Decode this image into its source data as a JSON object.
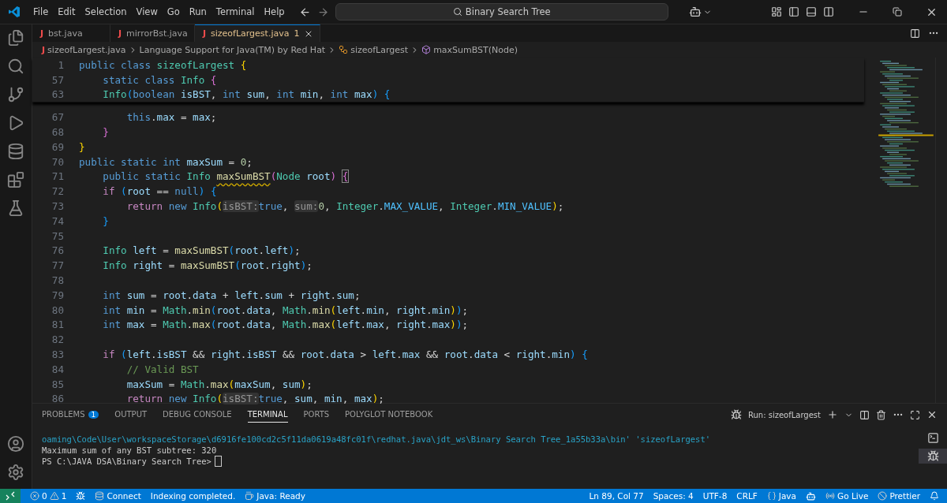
{
  "menu": [
    "File",
    "Edit",
    "Selection",
    "View",
    "Go",
    "Run",
    "Terminal",
    "Help"
  ],
  "search": {
    "value": "Binary Search Tree"
  },
  "tabs": [
    {
      "icon": "J",
      "label": "bst.java",
      "selected": false
    },
    {
      "icon": "J",
      "label": "mirrorBst.java",
      "selected": false
    },
    {
      "icon": "J",
      "label": "sizeofLargest.java",
      "selected": true,
      "problems": "1"
    }
  ],
  "breadcrumb": [
    {
      "icon": "J",
      "label": "sizeofLargest.java"
    },
    {
      "label": "Language Support for Java(TM) by Red Hat"
    },
    {
      "label": "sizeofLargest"
    },
    {
      "label": "maxSumBST(Node)"
    }
  ],
  "sticky_lines": [
    {
      "n": "1",
      "tokens": [
        {
          "kind": "kw",
          "text": "public class "
        },
        {
          "kind": "type",
          "text": "sizeofLargest "
        },
        {
          "kind": "b1",
          "text": "{"
        }
      ]
    },
    {
      "n": "57",
      "tokens": [
        {
          "kind": "kw",
          "text": "    static class "
        },
        {
          "kind": "type",
          "text": "Info "
        },
        {
          "kind": "b2",
          "text": "{"
        }
      ]
    },
    {
      "n": "63",
      "tokens": [
        {
          "kind": "type",
          "text": "    Info"
        },
        {
          "kind": "b3",
          "text": "("
        },
        {
          "kind": "kw",
          "text": "boolean "
        },
        {
          "kind": "var",
          "text": "isBST"
        },
        {
          "kind": "p",
          "text": ", "
        },
        {
          "kind": "kw",
          "text": "int "
        },
        {
          "kind": "var",
          "text": "sum"
        },
        {
          "kind": "p",
          "text": ", "
        },
        {
          "kind": "kw",
          "text": "int "
        },
        {
          "kind": "var",
          "text": "min"
        },
        {
          "kind": "p",
          "text": ", "
        },
        {
          "kind": "kw",
          "text": "int "
        },
        {
          "kind": "var",
          "text": "max"
        },
        {
          "kind": "b3",
          "text": ") "
        },
        {
          "kind": "b3",
          "text": "{"
        }
      ]
    }
  ],
  "lines": [
    {
      "n": "67",
      "tokens": [
        {
          "kind": "kw",
          "text": "        this"
        },
        {
          "kind": "p",
          "text": "."
        },
        {
          "kind": "var",
          "text": "max"
        },
        {
          "kind": "p",
          "text": " = "
        },
        {
          "kind": "var",
          "text": "max"
        },
        {
          "kind": "p",
          "text": ";"
        }
      ]
    },
    {
      "n": "68",
      "tokens": [
        {
          "kind": "b2",
          "text": "    }"
        }
      ]
    },
    {
      "n": "69",
      "tokens": [
        {
          "kind": "b1",
          "text": "}"
        }
      ]
    },
    {
      "n": "70",
      "tokens": [
        {
          "kind": "kw",
          "text": "public static int "
        },
        {
          "kind": "var",
          "text": "maxSum"
        },
        {
          "kind": "p",
          "text": " = "
        },
        {
          "kind": "num",
          "text": "0"
        },
        {
          "kind": "p",
          "text": ";"
        }
      ]
    },
    {
      "n": "71",
      "tokens": [
        {
          "kind": "kw",
          "text": "    public static "
        },
        {
          "kind": "type",
          "text": "Info "
        },
        {
          "kind": "fnw",
          "text": "maxSumBST"
        },
        {
          "kind": "b2",
          "text": "("
        },
        {
          "kind": "type",
          "text": "Node "
        },
        {
          "kind": "var",
          "text": "root"
        },
        {
          "kind": "b2",
          "text": ") "
        },
        {
          "kind": "bm",
          "text": "{"
        }
      ]
    },
    {
      "n": "72",
      "tokens": [
        {
          "kind": "ctl",
          "text": "    if "
        },
        {
          "kind": "b3",
          "text": "("
        },
        {
          "kind": "var",
          "text": "root"
        },
        {
          "kind": "p",
          "text": " == "
        },
        {
          "kind": "kw",
          "text": "null"
        },
        {
          "kind": "b3",
          "text": ") "
        },
        {
          "kind": "b3",
          "text": "{"
        }
      ]
    },
    {
      "n": "73",
      "tokens": [
        {
          "kind": "ctl",
          "text": "        return "
        },
        {
          "kind": "kw",
          "text": "new "
        },
        {
          "kind": "type",
          "text": "Info"
        },
        {
          "kind": "b1",
          "text": "("
        },
        {
          "kind": "hint",
          "text": "isBST:"
        },
        {
          "kind": "kw",
          "text": "true"
        },
        {
          "kind": "p",
          "text": ", "
        },
        {
          "kind": "hint",
          "text": "sum:"
        },
        {
          "kind": "num",
          "text": "0"
        },
        {
          "kind": "p",
          "text": ", "
        },
        {
          "kind": "type",
          "text": "Integer"
        },
        {
          "kind": "p",
          "text": "."
        },
        {
          "kind": "const",
          "text": "MAX_VALUE"
        },
        {
          "kind": "p",
          "text": ", "
        },
        {
          "kind": "type",
          "text": "Integer"
        },
        {
          "kind": "p",
          "text": "."
        },
        {
          "kind": "const",
          "text": "MIN_VALUE"
        },
        {
          "kind": "b1",
          "text": ")"
        },
        {
          "kind": "p",
          "text": ";"
        }
      ]
    },
    {
      "n": "74",
      "tokens": [
        {
          "kind": "b3",
          "text": "    }"
        }
      ]
    },
    {
      "n": "75"
    },
    {
      "n": "76",
      "tokens": [
        {
          "kind": "type",
          "text": "    Info "
        },
        {
          "kind": "var",
          "text": "left"
        },
        {
          "kind": "p",
          "text": " = "
        },
        {
          "kind": "fn",
          "text": "maxSumBST"
        },
        {
          "kind": "b3",
          "text": "("
        },
        {
          "kind": "var",
          "text": "root"
        },
        {
          "kind": "p",
          "text": "."
        },
        {
          "kind": "var",
          "text": "left"
        },
        {
          "kind": "b3",
          "text": ")"
        },
        {
          "kind": "p",
          "text": ";"
        }
      ]
    },
    {
      "n": "77",
      "tokens": [
        {
          "kind": "type",
          "text": "    Info "
        },
        {
          "kind": "var",
          "text": "right"
        },
        {
          "kind": "p",
          "text": " = "
        },
        {
          "kind": "fn",
          "text": "maxSumBST"
        },
        {
          "kind": "b3",
          "text": "("
        },
        {
          "kind": "var",
          "text": "root"
        },
        {
          "kind": "p",
          "text": "."
        },
        {
          "kind": "var",
          "text": "right"
        },
        {
          "kind": "b3",
          "text": ")"
        },
        {
          "kind": "p",
          "text": ";"
        }
      ]
    },
    {
      "n": "78"
    },
    {
      "n": "79",
      "tokens": [
        {
          "kind": "kw",
          "text": "    int "
        },
        {
          "kind": "var",
          "text": "sum"
        },
        {
          "kind": "p",
          "text": " = "
        },
        {
          "kind": "var",
          "text": "root"
        },
        {
          "kind": "p",
          "text": "."
        },
        {
          "kind": "var",
          "text": "data"
        },
        {
          "kind": "p",
          "text": " + "
        },
        {
          "kind": "var",
          "text": "left"
        },
        {
          "kind": "p",
          "text": "."
        },
        {
          "kind": "var",
          "text": "sum"
        },
        {
          "kind": "p",
          "text": " + "
        },
        {
          "kind": "var",
          "text": "right"
        },
        {
          "kind": "p",
          "text": "."
        },
        {
          "kind": "var",
          "text": "sum"
        },
        {
          "kind": "p",
          "text": ";"
        }
      ]
    },
    {
      "n": "80",
      "tokens": [
        {
          "kind": "kw",
          "text": "    int "
        },
        {
          "kind": "var",
          "text": "min"
        },
        {
          "kind": "p",
          "text": " = "
        },
        {
          "kind": "type",
          "text": "Math"
        },
        {
          "kind": "p",
          "text": "."
        },
        {
          "kind": "fn",
          "text": "min"
        },
        {
          "kind": "b3",
          "text": "("
        },
        {
          "kind": "var",
          "text": "root"
        },
        {
          "kind": "p",
          "text": "."
        },
        {
          "kind": "var",
          "text": "data"
        },
        {
          "kind": "p",
          "text": ", "
        },
        {
          "kind": "type",
          "text": "Math"
        },
        {
          "kind": "p",
          "text": "."
        },
        {
          "kind": "fn",
          "text": "min"
        },
        {
          "kind": "b1",
          "text": "("
        },
        {
          "kind": "var",
          "text": "left"
        },
        {
          "kind": "p",
          "text": "."
        },
        {
          "kind": "var",
          "text": "min"
        },
        {
          "kind": "p",
          "text": ", "
        },
        {
          "kind": "var",
          "text": "right"
        },
        {
          "kind": "p",
          "text": "."
        },
        {
          "kind": "var",
          "text": "min"
        },
        {
          "kind": "b1",
          "text": ")"
        },
        {
          "kind": "b3",
          "text": ")"
        },
        {
          "kind": "p",
          "text": ";"
        }
      ]
    },
    {
      "n": "81",
      "tokens": [
        {
          "kind": "kw",
          "text": "    int "
        },
        {
          "kind": "var",
          "text": "max"
        },
        {
          "kind": "p",
          "text": " = "
        },
        {
          "kind": "type",
          "text": "Math"
        },
        {
          "kind": "p",
          "text": "."
        },
        {
          "kind": "fn",
          "text": "max"
        },
        {
          "kind": "b3",
          "text": "("
        },
        {
          "kind": "var",
          "text": "root"
        },
        {
          "kind": "p",
          "text": "."
        },
        {
          "kind": "var",
          "text": "data"
        },
        {
          "kind": "p",
          "text": ", "
        },
        {
          "kind": "type",
          "text": "Math"
        },
        {
          "kind": "p",
          "text": "."
        },
        {
          "kind": "fn",
          "text": "max"
        },
        {
          "kind": "b1",
          "text": "("
        },
        {
          "kind": "var",
          "text": "left"
        },
        {
          "kind": "p",
          "text": "."
        },
        {
          "kind": "var",
          "text": "max"
        },
        {
          "kind": "p",
          "text": ", "
        },
        {
          "kind": "var",
          "text": "right"
        },
        {
          "kind": "p",
          "text": "."
        },
        {
          "kind": "var",
          "text": "max"
        },
        {
          "kind": "b1",
          "text": ")"
        },
        {
          "kind": "b3",
          "text": ")"
        },
        {
          "kind": "p",
          "text": ";"
        }
      ]
    },
    {
      "n": "82"
    },
    {
      "n": "83",
      "tokens": [
        {
          "kind": "ctl",
          "text": "    if "
        },
        {
          "kind": "b3",
          "text": "("
        },
        {
          "kind": "var",
          "text": "left"
        },
        {
          "kind": "p",
          "text": "."
        },
        {
          "kind": "var",
          "text": "isBST"
        },
        {
          "kind": "p",
          "text": " && "
        },
        {
          "kind": "var",
          "text": "right"
        },
        {
          "kind": "p",
          "text": "."
        },
        {
          "kind": "var",
          "text": "isBST"
        },
        {
          "kind": "p",
          "text": " && "
        },
        {
          "kind": "var",
          "text": "root"
        },
        {
          "kind": "p",
          "text": "."
        },
        {
          "kind": "var",
          "text": "data"
        },
        {
          "kind": "p",
          "text": " > "
        },
        {
          "kind": "var",
          "text": "left"
        },
        {
          "kind": "p",
          "text": "."
        },
        {
          "kind": "var",
          "text": "max"
        },
        {
          "kind": "p",
          "text": " && "
        },
        {
          "kind": "var",
          "text": "root"
        },
        {
          "kind": "p",
          "text": "."
        },
        {
          "kind": "var",
          "text": "data"
        },
        {
          "kind": "p",
          "text": " < "
        },
        {
          "kind": "var",
          "text": "right"
        },
        {
          "kind": "p",
          "text": "."
        },
        {
          "kind": "var",
          "text": "min"
        },
        {
          "kind": "b3",
          "text": ") "
        },
        {
          "kind": "b3",
          "text": "{"
        }
      ]
    },
    {
      "n": "84",
      "tokens": [
        {
          "kind": "cm",
          "text": "        // Valid BST"
        }
      ]
    },
    {
      "n": "85",
      "tokens": [
        {
          "kind": "var",
          "text": "        maxSum"
        },
        {
          "kind": "p",
          "text": " = "
        },
        {
          "kind": "type",
          "text": "Math"
        },
        {
          "kind": "p",
          "text": "."
        },
        {
          "kind": "fn",
          "text": "max"
        },
        {
          "kind": "b1",
          "text": "("
        },
        {
          "kind": "var",
          "text": "maxSum"
        },
        {
          "kind": "p",
          "text": ", "
        },
        {
          "kind": "var",
          "text": "sum"
        },
        {
          "kind": "b1",
          "text": ")"
        },
        {
          "kind": "p",
          "text": ";"
        }
      ]
    },
    {
      "n": "86",
      "tokens": [
        {
          "kind": "ctl",
          "text": "        return "
        },
        {
          "kind": "kw",
          "text": "new "
        },
        {
          "kind": "type",
          "text": "Info"
        },
        {
          "kind": "b1",
          "text": "("
        },
        {
          "kind": "hint",
          "text": "isBST:"
        },
        {
          "kind": "kw",
          "text": "true"
        },
        {
          "kind": "p",
          "text": ", "
        },
        {
          "kind": "var",
          "text": "sum"
        },
        {
          "kind": "p",
          "text": ", "
        },
        {
          "kind": "var",
          "text": "min"
        },
        {
          "kind": "p",
          "text": ", "
        },
        {
          "kind": "var",
          "text": "max"
        },
        {
          "kind": "b1",
          "text": ")"
        },
        {
          "kind": "p",
          "text": ";"
        }
      ]
    }
  ],
  "panel_tabs": [
    {
      "label": "PROBLEMS",
      "selected": false,
      "badge": "1"
    },
    {
      "label": "OUTPUT",
      "selected": false
    },
    {
      "label": "DEBUG CONSOLE",
      "selected": false
    },
    {
      "label": "TERMINAL",
      "selected": true
    },
    {
      "label": "PORTS",
      "selected": false
    },
    {
      "label": "POLYGLOT NOTEBOOK",
      "selected": false
    }
  ],
  "run_label": "Run: sizeofLargest",
  "terminal": [
    {
      "kind": "command",
      "text": "oaming\\Code\\User\\workspaceStorage\\d6916fe100cd2c5f11da0619a48fc01f\\redhat.java\\jdt_ws\\Binary Search Tree_1a55b33a\\bin' 'sizeofLargest'"
    },
    {
      "kind": "output",
      "text": "Maximum sum of any BST subtree: 320"
    },
    {
      "kind": "prompt",
      "text": "PS C:\\JAVA DSA\\Binary Search Tree>"
    }
  ],
  "status": {
    "errors": "0",
    "warnings": "1",
    "connect": "Connect",
    "indexing": "Indexing completed.",
    "java_ready": "Java: Ready",
    "position": "Ln 89, Col 77",
    "spaces": "Spaces: 4",
    "encoding": "UTF-8",
    "eol": "CRLF",
    "language": "Java",
    "go_live": "Go Live",
    "prettier": "Prettier"
  }
}
